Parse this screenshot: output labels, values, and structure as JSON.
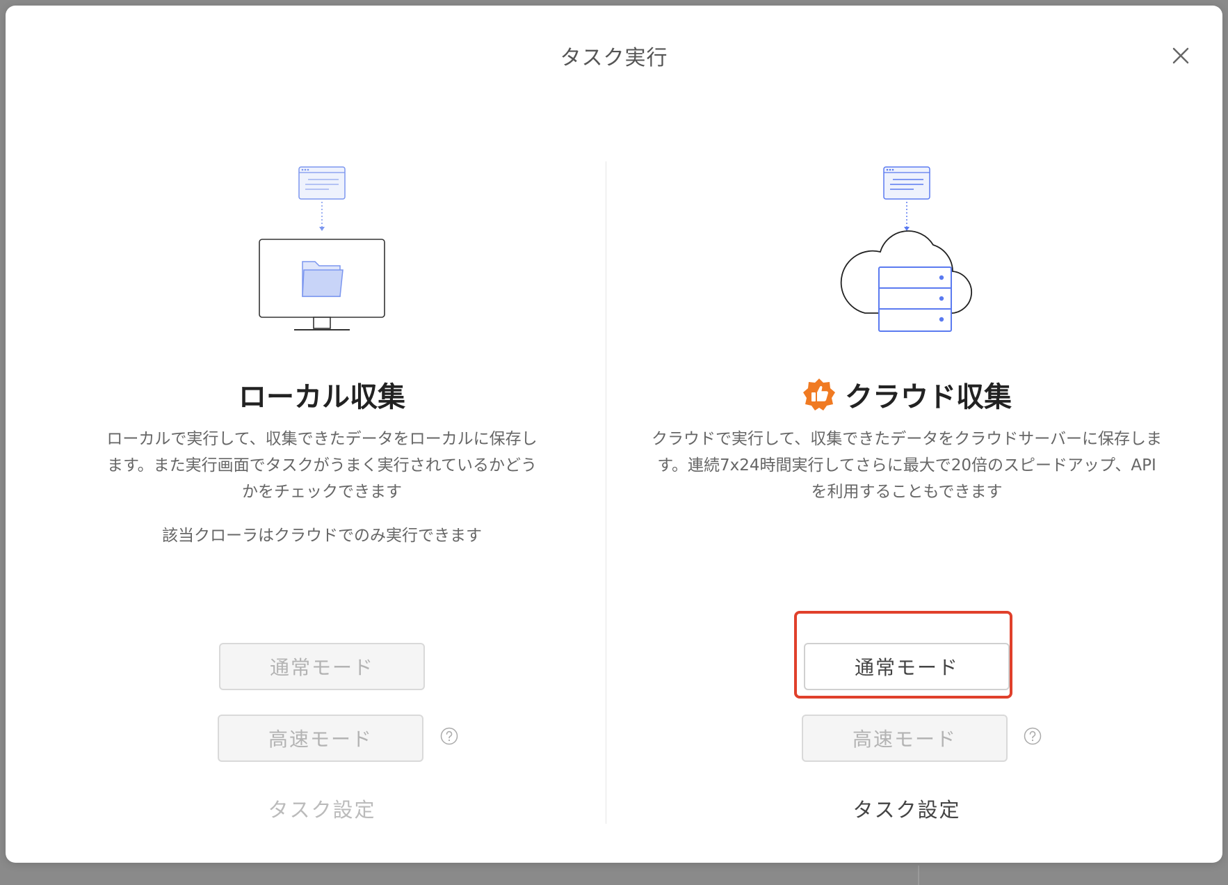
{
  "dialog": {
    "title": "タスク実行",
    "close_label": "×"
  },
  "local": {
    "heading": "ローカル収集",
    "description": "ローカルで実行して、収集できたデータをローカルに保存します。また実行画面でタスクがうまく実行されているかどうかをチェックできます",
    "note": "該当クローラはクラウドでのみ実行できます",
    "normal_mode_label": "通常モード",
    "fast_mode_label": "高速モード",
    "task_settings_label": "タスク設定",
    "icon": "monitor-folder-illustration"
  },
  "cloud": {
    "heading": "クラウド収集",
    "description": "クラウドで実行して、収集できたデータをクラウドサーバーに保存します。連続7x24時間実行してさらに最大で20倍のスピードアップ、APIを利用することもできます",
    "normal_mode_label": "通常モード",
    "fast_mode_label": "高速モード",
    "task_settings_label": "タスク設定",
    "icon": "cloud-server-illustration",
    "badge_icon": "thumbs-up-badge-icon"
  },
  "colors": {
    "accent_blue": "#4a6cf7",
    "badge_orange": "#f07a22",
    "highlight_red": "#e0402b"
  }
}
